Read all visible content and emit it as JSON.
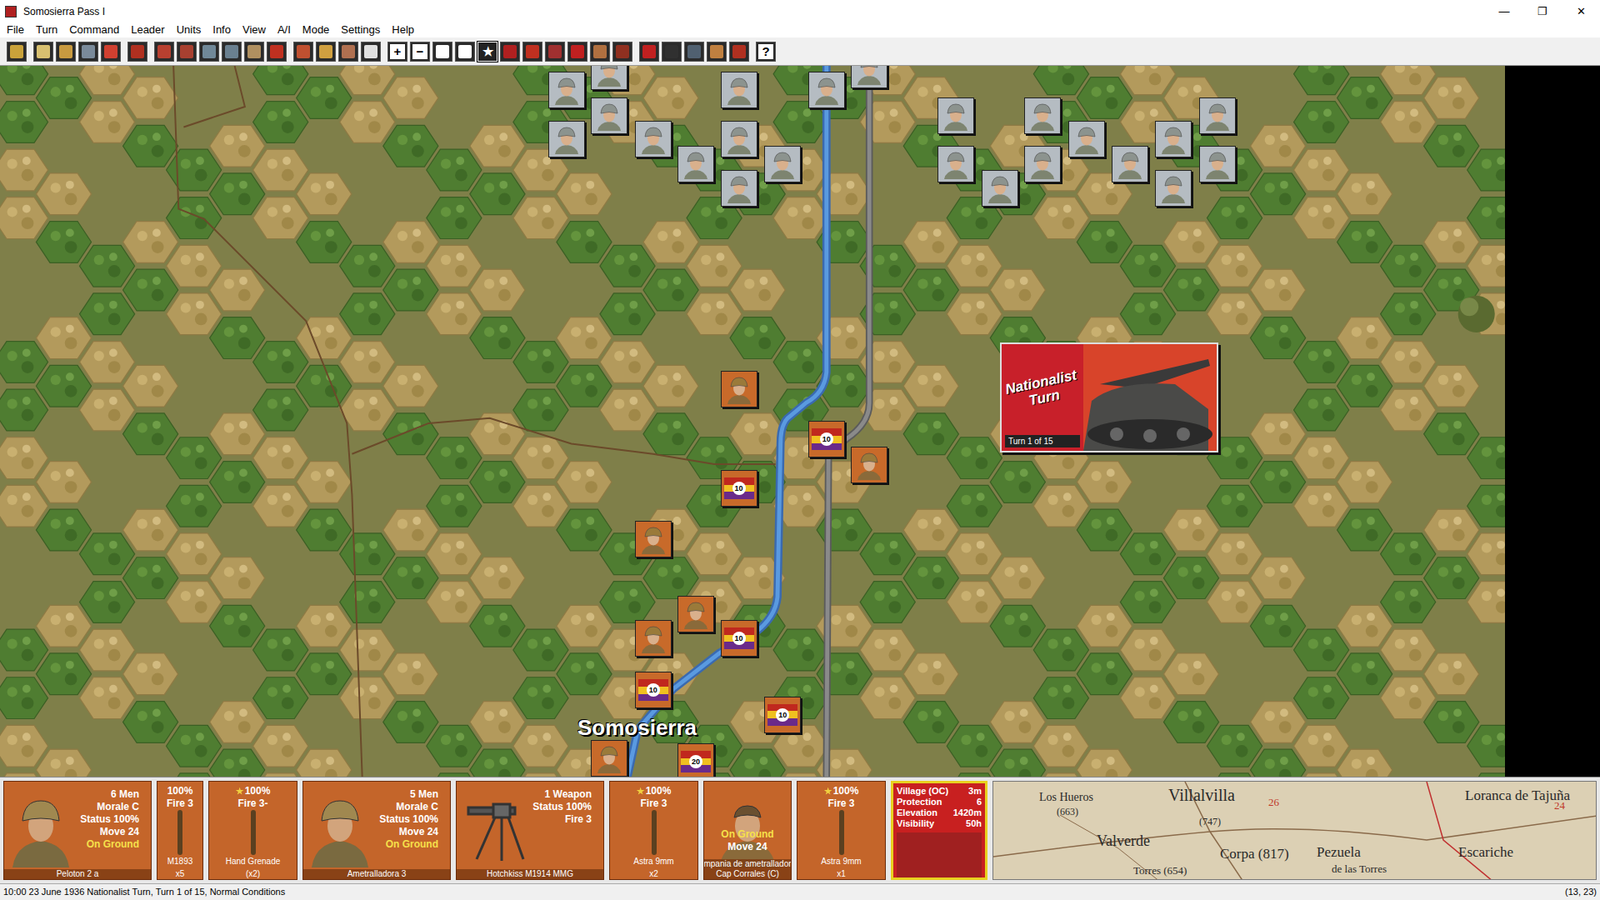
{
  "window": {
    "title": "Somosierra Pass I",
    "controls": [
      "—",
      "❐",
      "✕"
    ]
  },
  "menu": [
    "File",
    "Turn",
    "Command",
    "Leader",
    "Units",
    "Info",
    "View",
    "A/I",
    "Mode",
    "Settings",
    "Help"
  ],
  "toolbar": [
    {
      "glyph": "",
      "selected": false
    },
    {
      "glyph": "",
      "selected": false
    },
    {
      "glyph": "",
      "selected": false
    },
    {
      "glyph": "",
      "selected": false
    },
    {
      "glyph": "",
      "selected": false
    },
    {
      "glyph": "",
      "selected": false
    },
    {
      "glyph": "",
      "selected": false
    },
    {
      "glyph": "",
      "selected": false
    },
    {
      "glyph": "",
      "selected": false
    },
    {
      "glyph": "",
      "selected": false
    },
    {
      "glyph": "",
      "selected": false
    },
    {
      "glyph": "",
      "selected": false
    },
    {
      "glyph": "",
      "selected": false
    },
    {
      "glyph": "",
      "selected": false
    },
    {
      "glyph": "",
      "selected": false
    },
    {
      "glyph": "",
      "selected": false
    },
    {
      "glyph": "+",
      "selected": false
    },
    {
      "glyph": "−",
      "selected": false
    },
    {
      "glyph": "",
      "selected": false
    },
    {
      "glyph": "",
      "selected": false
    },
    {
      "glyph": "★",
      "selected": true
    },
    {
      "glyph": "",
      "selected": false
    },
    {
      "glyph": "",
      "selected": false
    },
    {
      "glyph": "",
      "selected": false
    },
    {
      "glyph": "",
      "selected": false
    },
    {
      "glyph": "",
      "selected": false
    },
    {
      "glyph": "",
      "selected": false
    },
    {
      "glyph": "",
      "selected": false
    },
    {
      "glyph": "",
      "selected": false
    },
    {
      "glyph": "",
      "selected": false
    },
    {
      "glyph": "",
      "selected": false
    },
    {
      "glyph": "",
      "selected": false
    },
    {
      "glyph": "?",
      "selected": false
    }
  ],
  "map": {
    "place_label": "Somosierra",
    "units": [
      {
        "side": "nationalist",
        "kind": "infantry"
      },
      {
        "side": "nationalist",
        "kind": "infantry"
      },
      {
        "side": "nationalist",
        "kind": "infantry"
      },
      {
        "side": "nationalist",
        "kind": "infantry"
      },
      {
        "side": "nationalist",
        "kind": "infantry"
      },
      {
        "side": "nationalist",
        "kind": "infantry"
      },
      {
        "side": "nationalist",
        "kind": "infantry"
      },
      {
        "side": "nationalist",
        "kind": "infantry"
      },
      {
        "side": "nationalist",
        "kind": "infantry"
      },
      {
        "side": "nationalist",
        "kind": "infantry"
      },
      {
        "side": "nationalist",
        "kind": "infantry"
      },
      {
        "side": "nationalist",
        "kind": "infantry"
      },
      {
        "side": "nationalist",
        "kind": "infantry"
      },
      {
        "side": "nationalist",
        "kind": "infantry"
      },
      {
        "side": "nationalist",
        "kind": "infantry"
      },
      {
        "side": "nationalist",
        "kind": "infantry"
      },
      {
        "side": "nationalist",
        "kind": "infantry"
      },
      {
        "side": "nationalist",
        "kind": "infantry"
      },
      {
        "side": "nationalist",
        "kind": "infantry"
      },
      {
        "side": "nationalist",
        "kind": "infantry"
      },
      {
        "side": "nationalist",
        "kind": "infantry"
      },
      {
        "side": "nationalist",
        "kind": "infantry"
      },
      {
        "side": "nationalist",
        "kind": "infantry"
      },
      {
        "side": "republican",
        "kind": "infantry"
      },
      {
        "side": "republican",
        "kind": "infantry"
      },
      {
        "side": "republican",
        "kind": "infantry"
      },
      {
        "side": "republican",
        "kind": "infantry"
      },
      {
        "side": "republican",
        "kind": "infantry"
      },
      {
        "side": "republican",
        "kind": "infantry"
      },
      {
        "side": "republican",
        "kind": "flag",
        "label": "10"
      },
      {
        "side": "republican",
        "kind": "flag",
        "label": "10"
      },
      {
        "side": "republican",
        "kind": "flag",
        "label": "10"
      },
      {
        "side": "republican",
        "kind": "flag",
        "label": "10"
      },
      {
        "side": "republican",
        "kind": "flag",
        "label": "10"
      },
      {
        "side": "republican",
        "kind": "flag",
        "label": "20"
      }
    ]
  },
  "turn_popup": {
    "title_lines": [
      "Nationalist",
      "Turn"
    ],
    "counter": "Turn 1 of 15"
  },
  "unit_cards": [
    {
      "kind": "unit",
      "lines": [
        "6 Men",
        "Morale C",
        "Status 100%",
        "Move 24"
      ],
      "status": "On Ground",
      "name": "Peloton 2 a"
    },
    {
      "kind": "weapon",
      "status": "100%",
      "fire": "Fire 3",
      "name": "M1893",
      "count": "x5",
      "starred": false
    },
    {
      "kind": "weapon",
      "status": "100%",
      "fire": "Fire 3-",
      "name": "Hand Grenade",
      "count": "(x2)",
      "starred": true
    },
    {
      "kind": "unit",
      "lines": [
        "5 Men",
        "Morale C",
        "Status 100%",
        "Move 24"
      ],
      "status": "On Ground",
      "name": "Ametralladora 3"
    },
    {
      "kind": "gun",
      "lines": [
        "1 Weapon",
        "Status 100%",
        "Fire 3"
      ],
      "name": "Hotchkiss M1914 MMG"
    },
    {
      "kind": "weapon",
      "status": "100%",
      "fire": "Fire 3",
      "name": "Astra 9mm",
      "count": "x2",
      "starred": true
    },
    {
      "kind": "leader",
      "lines": [
        "On Ground",
        "Move 24"
      ],
      "unit": "mpania de ametrallador",
      "name": "Cap Corrales (C)"
    },
    {
      "kind": "weapon",
      "status": "100%",
      "fire": "Fire 3",
      "name": "Astra 9mm",
      "count": "x1",
      "starred": true
    }
  ],
  "terrain": {
    "name": "Village (OC)",
    "time": "3m",
    "highlighted": true,
    "rows": [
      {
        "label": "Protection",
        "value": "6"
      },
      {
        "label": "Elevation",
        "value": "1420m"
      },
      {
        "label": "Visibility",
        "value": "50h"
      }
    ]
  },
  "minimap": {
    "labels": [
      {
        "text": "Los Hueros",
        "color": "#2a2a2a"
      },
      {
        "text": "(663)",
        "color": "#2a2a2a"
      },
      {
        "text": "Villalvilla",
        "color": "#2a2a2a"
      },
      {
        "text": "(747)",
        "color": "#2a2a2a"
      },
      {
        "text": "Valverde",
        "color": "#2a2a2a"
      },
      {
        "text": "Corpa (817)",
        "color": "#2a2a2a"
      },
      {
        "text": "Pezuela",
        "color": "#2a2a2a"
      },
      {
        "text": "de las Torres",
        "color": "#2a2a2a"
      },
      {
        "text": "Escariche",
        "color": "#2a2a2a"
      },
      {
        "text": "Loranca de Tajuña",
        "color": "#2a2a2a"
      },
      {
        "text": "Torres (654)",
        "color": "#2a2a2a"
      },
      {
        "text": "26",
        "color": "#c0392b"
      },
      {
        "text": "24",
        "color": "#c0392b"
      }
    ]
  },
  "status_bar": {
    "text": "10:00 23 June 1936 Nationalist Turn, Turn 1 of 15, Normal Conditions",
    "coords": "(13, 23)"
  }
}
